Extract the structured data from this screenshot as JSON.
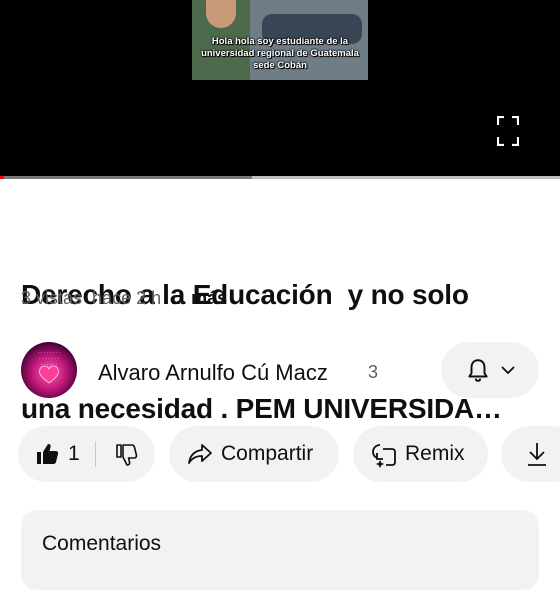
{
  "player": {
    "caption": "Hola hola soy estudiante de la universidad regional de Guatemala sede Cobán",
    "progress_fraction": 0.003,
    "buffer_fraction": 0.45
  },
  "video": {
    "title_line1": "Derecho a la Educación  y no solo",
    "title_line2": "una necesidad . PEM UNIVERSIDA…",
    "views": "3 vistas",
    "age": "hace 2 h",
    "more": "... más"
  },
  "channel": {
    "name": "Alvaro Arnulfo Cú Macz",
    "subscribers": "3"
  },
  "actions": {
    "like_count": "1",
    "share_label": "Compartir",
    "remix_label": "Remix"
  },
  "comments": {
    "label": "Comentarios"
  },
  "colors": {
    "progress": "#ff0000",
    "pill_bg": "#f2f2f2",
    "secondary_text": "#606060"
  }
}
